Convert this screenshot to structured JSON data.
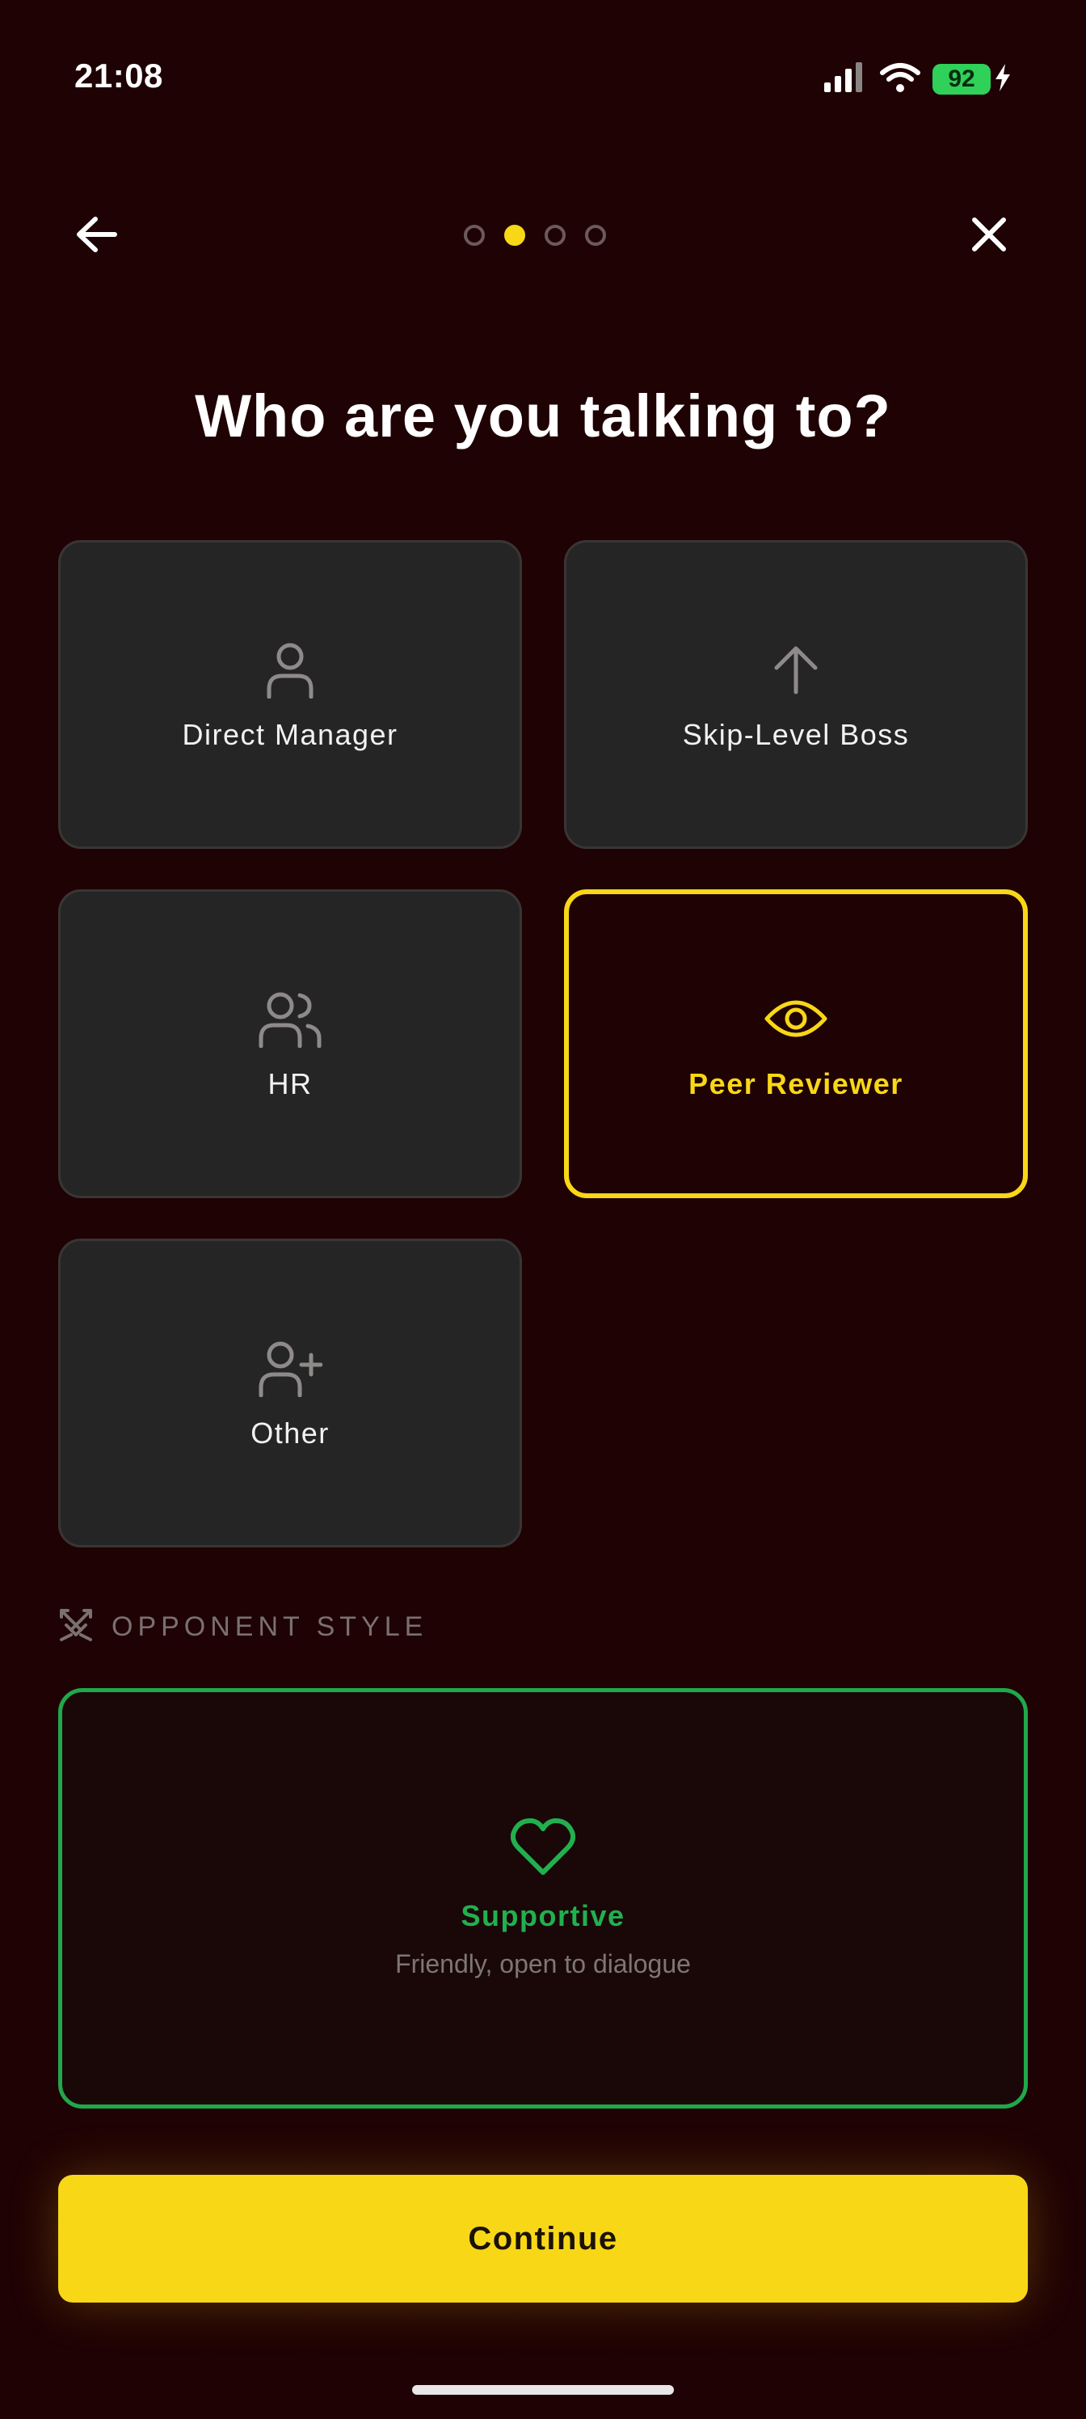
{
  "status_bar": {
    "time": "21:08",
    "battery": "92",
    "icons": [
      "cellular-signal-icon",
      "wifi-icon",
      "battery-icon",
      "charging-bolt-icon"
    ]
  },
  "nav": {
    "back_icon": "arrow-left-icon",
    "close_icon": "close-icon",
    "progress": {
      "total_steps": 4,
      "current_step": 2
    }
  },
  "page_title": "Who are you talking to?",
  "roles": [
    {
      "label": "Direct Manager",
      "icon": "person-icon",
      "selected": false
    },
    {
      "label": "Skip-Level Boss",
      "icon": "arrow-up-icon",
      "selected": false
    },
    {
      "label": "HR",
      "icon": "people-icon",
      "selected": false
    },
    {
      "label": "Peer Reviewer",
      "icon": "eye-icon",
      "selected": true
    },
    {
      "label": "Other",
      "icon": "person-add-icon",
      "selected": false
    }
  ],
  "opponent_section": {
    "label": "OPPONENT STYLE",
    "icon": "crossed-swords-icon",
    "selected_style": {
      "title": "Supportive",
      "description": "Friendly, open to dialogue",
      "icon": "heart-icon"
    }
  },
  "continue_label": "Continue",
  "colors": {
    "background": "#1f0204",
    "accent_yellow": "#f8d717",
    "supportive_green": "#22b04f",
    "card_background": "#252525"
  }
}
